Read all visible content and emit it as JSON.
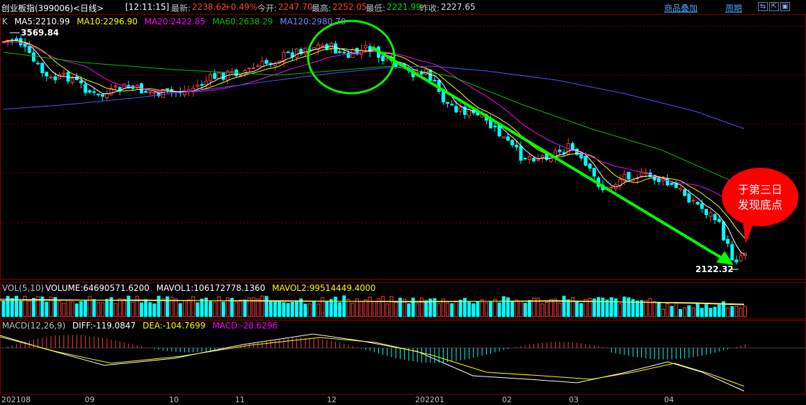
{
  "header": {
    "instrument": "创业板指(399006)<日线>",
    "time": "[12:11:15]",
    "latest_label": "最新:",
    "latest_value": "2238.62",
    "change": "+0.49%",
    "open_label": "今开:",
    "open_value": "2247.70",
    "high_label": "最高:",
    "high_value": "2252.05",
    "low_label": "最低:",
    "low_value": "2221.99",
    "prev_close_label": "昨收:",
    "prev_close_value": "2227.65",
    "overlay_button": "商品叠加",
    "period_button": "周期",
    "window_icons": [
      "restore-icon",
      "expand-icon",
      "maximize-icon"
    ]
  },
  "kline_legend": {
    "k": "K",
    "ma5": "MA5:2210.99",
    "ma10": "MA10:2296.90",
    "ma20": "MA20:2422.85",
    "ma60": "MA60:2638.29",
    "ma120": "MA120:2980.70"
  },
  "vol_legend": {
    "title": "VOL(5,10)",
    "volume": "VOLUME:64690571.6200",
    "mavol1": "MAVOL1:106172778.1360",
    "mavol2": "MAVOL2:99514449.4000"
  },
  "macd_legend": {
    "title": "MACD(12,26,9)",
    "diff": "DIFF:-119.0847",
    "dea": "DEA:-104.7699",
    "macd": "MACD:-28.6296"
  },
  "annotations": {
    "high_marker": "3569.84",
    "low_marker": "2122.32",
    "callout": [
      "于第三日",
      "发现底点"
    ]
  },
  "x_axis": [
    "202108",
    "09",
    "10",
    "11",
    "12",
    "202201",
    "02",
    "03",
    "04"
  ],
  "colors": {
    "up": "#ff3c3c",
    "down": "#00ffff",
    "ma5": "#ffffff",
    "ma10": "#ffff00",
    "ma20": "#ff00ff",
    "ma60": "#00c000",
    "ma120": "#5050ff",
    "trend": "#00ff00",
    "callout": "#ff0000"
  },
  "chart_data": {
    "type": "candlestick",
    "start_price": 3450,
    "peak_price": 3569.84,
    "bottom_price": 2122.32,
    "last_price": 2238.62
  }
}
